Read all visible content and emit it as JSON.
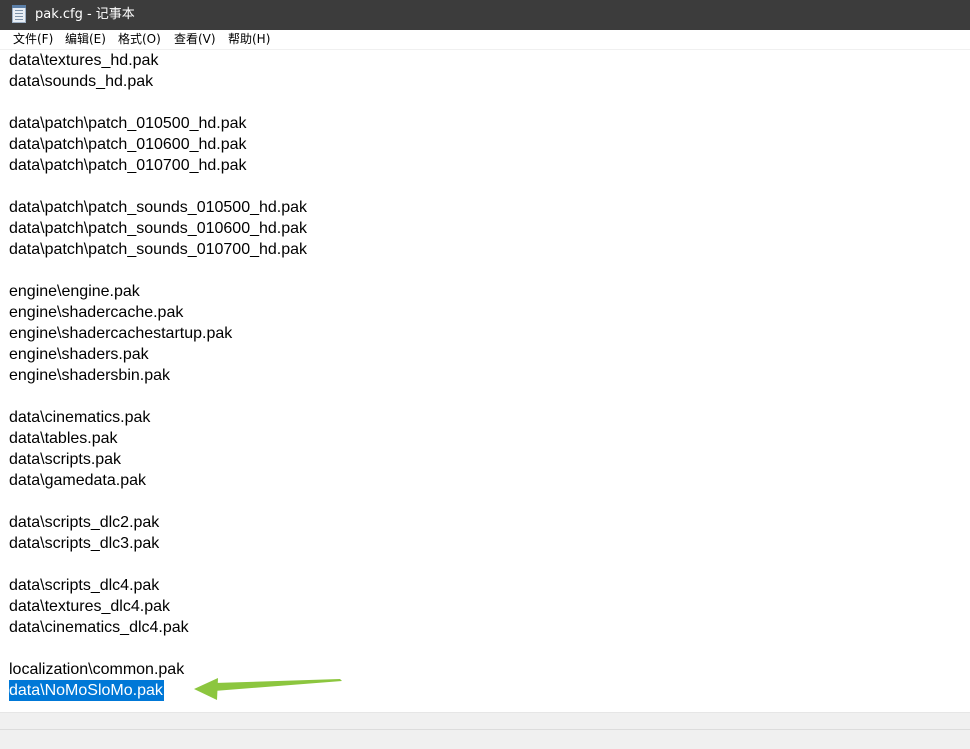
{
  "window": {
    "title": "pak.cfg - 记事本",
    "icon": "notepad-icon"
  },
  "menu": {
    "file": "文件(F)",
    "edit": "编辑(E)",
    "format": "格式(O)",
    "view": "查看(V)",
    "help": "帮助(H)"
  },
  "editor": {
    "lines": [
      "data\\textures_hd.pak",
      "data\\sounds_hd.pak",
      "",
      "data\\patch\\patch_010500_hd.pak",
      "data\\patch\\patch_010600_hd.pak",
      "data\\patch\\patch_010700_hd.pak",
      "",
      "data\\patch\\patch_sounds_010500_hd.pak",
      "data\\patch\\patch_sounds_010600_hd.pak",
      "data\\patch\\patch_sounds_010700_hd.pak",
      "",
      "engine\\engine.pak",
      "engine\\shadercache.pak",
      "engine\\shadercachestartup.pak",
      "engine\\shaders.pak",
      "engine\\shadersbin.pak",
      "",
      "data\\cinematics.pak",
      "data\\tables.pak",
      "data\\scripts.pak",
      "data\\gamedata.pak",
      "",
      "data\\scripts_dlc2.pak",
      "data\\scripts_dlc3.pak",
      "",
      "data\\scripts_dlc4.pak",
      "data\\textures_dlc4.pak",
      "data\\cinematics_dlc4.pak",
      "",
      "localization\\common.pak",
      "data\\NoMoSloMo.pak"
    ],
    "selected_line_index": 30
  },
  "annotation": {
    "icon": "arrow-icon",
    "color": "#8cc63f"
  },
  "colors": {
    "titlebar": "#3c3c3c",
    "selection": "#0078d7"
  }
}
